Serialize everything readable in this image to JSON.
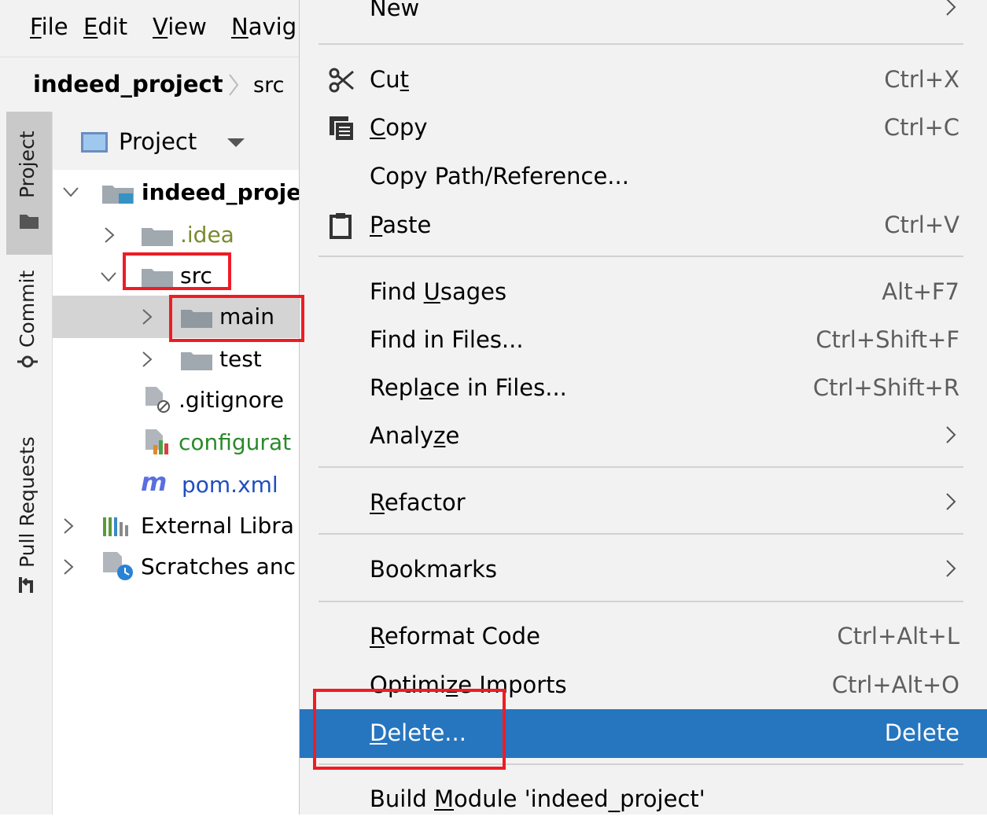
{
  "menubar": {
    "items": [
      {
        "mnemonic": "F",
        "rest": "ile"
      },
      {
        "mnemonic": "E",
        "rest": "dit"
      },
      {
        "mnemonic": "V",
        "rest": "iew"
      },
      {
        "mnemonic": "N",
        "rest": "avig"
      }
    ]
  },
  "breadcrumb": {
    "root": "indeed_project",
    "child": "src"
  },
  "toolstrip": {
    "project_label": "Project",
    "commit_label": "Commit",
    "pull_requests_label": "Pull Requests"
  },
  "project_panel": {
    "title": "Project",
    "tree": {
      "root": "indeed_proje",
      "idea": ".idea",
      "src": "src",
      "main": "main",
      "test": "test",
      "gitignore": ".gitignore",
      "configuration": "configurat",
      "pom": "pom.xml",
      "external": "External Libra",
      "scratches": "Scratches anc"
    }
  },
  "context_menu": {
    "new": {
      "label": "New"
    },
    "cut": {
      "pre": "Cu",
      "mn": "t",
      "post": "",
      "shortcut": "Ctrl+X"
    },
    "copy": {
      "pre": "",
      "mn": "C",
      "post": "opy",
      "shortcut": "Ctrl+C"
    },
    "copy_path": {
      "label": "Copy Path/Reference..."
    },
    "paste": {
      "pre": "",
      "mn": "P",
      "post": "aste",
      "shortcut": "Ctrl+V"
    },
    "find_usages": {
      "pre": "Find ",
      "mn": "U",
      "post": "sages",
      "shortcut": "Alt+F7"
    },
    "find_in_files": {
      "label": "Find in Files...",
      "shortcut": "Ctrl+Shift+F"
    },
    "replace_in_files": {
      "pre": "Repl",
      "mn": "a",
      "post": "ce in Files...",
      "shortcut": "Ctrl+Shift+R"
    },
    "analyze": {
      "pre": "Analy",
      "mn": "z",
      "post": "e"
    },
    "refactor": {
      "pre": "",
      "mn": "R",
      "post": "efactor"
    },
    "bookmarks": {
      "label": "Bookmarks"
    },
    "reformat": {
      "pre": "",
      "mn": "R",
      "post": "eformat Code",
      "shortcut": "Ctrl+Alt+L"
    },
    "optimize": {
      "pre": "Optimi",
      "mn": "z",
      "post": "e Imports",
      "shortcut": "Ctrl+Alt+O"
    },
    "delete": {
      "pre": "",
      "mn": "D",
      "post": "elete...",
      "shortcut": "Delete"
    },
    "build_module": {
      "pre": "Build ",
      "mn": "M",
      "post": "odule 'indeed_project'"
    }
  },
  "colors": {
    "highlight": "#2675bf",
    "annotation_red": "#ef1c24",
    "menu_bg": "#f2f2f2",
    "selected_row": "#d4d4d4"
  }
}
